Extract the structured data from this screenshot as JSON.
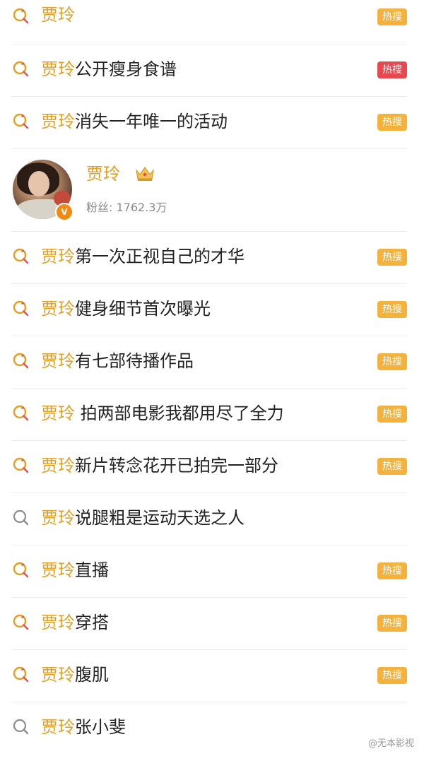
{
  "keyword": "贾玲",
  "colors": {
    "keyword": "#e79d1e",
    "badge_hot_orange": "#f4b23c",
    "badge_hot_red": "#e8474f",
    "icon_orange": "#e79d1e",
    "icon_red": "#e0555b",
    "icon_gray": "#8c8c8c"
  },
  "results": [
    {
      "suffix": "",
      "badge": "热搜",
      "badge_color": "orange",
      "icon": "trending-search-icon"
    },
    {
      "suffix": "公开瘦身食谱",
      "badge": "热搜",
      "badge_color": "red",
      "icon": "trending-search-icon"
    },
    {
      "suffix": "消失一年唯一的活动",
      "badge": "热搜",
      "badge_color": "orange",
      "icon": "trending-search-icon"
    }
  ],
  "profile": {
    "name": "贾玲",
    "fans_label": "粉丝: 1762.3万",
    "verified_icon": "verified-v-icon",
    "crown_icon": "crown-icon"
  },
  "results2": [
    {
      "suffix": "第一次正视自己的才华",
      "badge": "热搜",
      "badge_color": "orange",
      "icon": "trending-search-icon"
    },
    {
      "suffix": "健身细节首次曝光",
      "badge": "热搜",
      "badge_color": "orange",
      "icon": "trending-search-icon"
    },
    {
      "suffix": "有七部待播作品",
      "badge": "热搜",
      "badge_color": "orange",
      "icon": "trending-search-icon"
    },
    {
      "suffix": " 拍两部电影我都用尽了全力",
      "badge": "热搜",
      "badge_color": "orange",
      "icon": "trending-search-icon"
    },
    {
      "suffix": "新片转念花开已拍完一部分",
      "badge": "热搜",
      "badge_color": "orange",
      "icon": "trending-search-icon"
    },
    {
      "suffix": "说腿粗是运动天选之人",
      "badge": "",
      "badge_color": "",
      "icon": "search-icon"
    },
    {
      "suffix": "直播",
      "badge": "热搜",
      "badge_color": "orange",
      "icon": "trending-search-icon"
    },
    {
      "suffix": "穿搭",
      "badge": "热搜",
      "badge_color": "orange",
      "icon": "trending-search-icon"
    },
    {
      "suffix": "腹肌",
      "badge": "热搜",
      "badge_color": "orange",
      "icon": "trending-search-icon"
    },
    {
      "suffix": "张小斐",
      "badge": "",
      "badge_color": "",
      "icon": "search-icon"
    }
  ],
  "watermark": "@无本影视"
}
